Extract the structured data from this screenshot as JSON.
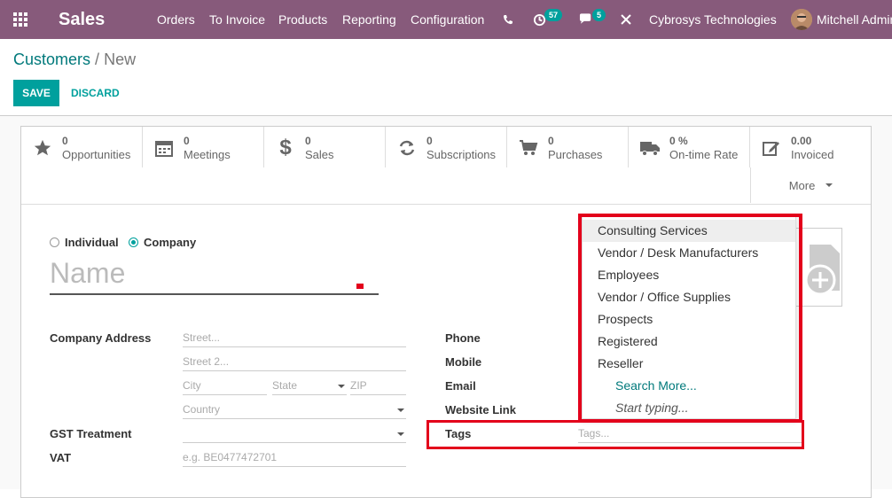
{
  "topbar": {
    "brand": "Sales",
    "menu": [
      "Orders",
      "To Invoice",
      "Products",
      "Reporting",
      "Configuration"
    ],
    "activity_count": "57",
    "message_count": "5",
    "company": "Cybrosys Technologies",
    "user": "Mitchell Admin",
    "colors": {
      "bar": "#875a7b",
      "badge": "#00a09d"
    }
  },
  "breadcrumb": {
    "parent": "Customers",
    "separator": "/",
    "current": "New"
  },
  "actions": {
    "save": "SAVE",
    "discard": "DISCARD"
  },
  "smart_buttons": [
    {
      "icon": "star-icon",
      "value": "0",
      "label": "Opportunities"
    },
    {
      "icon": "calendar-icon",
      "value": "0",
      "label": "Meetings"
    },
    {
      "icon": "dollar-icon",
      "value": "0",
      "label": "Sales"
    },
    {
      "icon": "refresh-icon",
      "value": "0",
      "label": "Subscriptions"
    },
    {
      "icon": "shopping-cart-icon",
      "value": "0",
      "label": "Purchases"
    },
    {
      "icon": "truck-icon",
      "value": "0 %",
      "label": "On-time Rate"
    },
    {
      "icon": "pencil-square-icon",
      "value": "0.00",
      "label": "Invoiced"
    }
  ],
  "more_label": "More",
  "company_type": {
    "individual": "Individual",
    "company": "Company",
    "selected": "company"
  },
  "name_placeholder": "Name",
  "address": {
    "label": "Company Address",
    "street": "Street...",
    "street2": "Street 2...",
    "city": "City",
    "state": "State",
    "zip": "ZIP",
    "country": "Country"
  },
  "gst": {
    "label": "GST Treatment",
    "value": ""
  },
  "vat": {
    "label": "VAT",
    "placeholder": "e.g. BE0477472701"
  },
  "right_fields": {
    "phone": "Phone",
    "mobile": "Mobile",
    "email": "Email",
    "website": "Website Link",
    "tags": "Tags",
    "tags_placeholder": "Tags..."
  },
  "tags_dropdown": {
    "items": [
      "Consulting Services",
      "Vendor / Desk Manufacturers",
      "Employees",
      "Vendor / Office Supplies",
      "Prospects",
      "Registered",
      "Reseller"
    ],
    "search_more": "Search More...",
    "start_typing": "Start typing..."
  },
  "highlight_color": "#e3001b"
}
